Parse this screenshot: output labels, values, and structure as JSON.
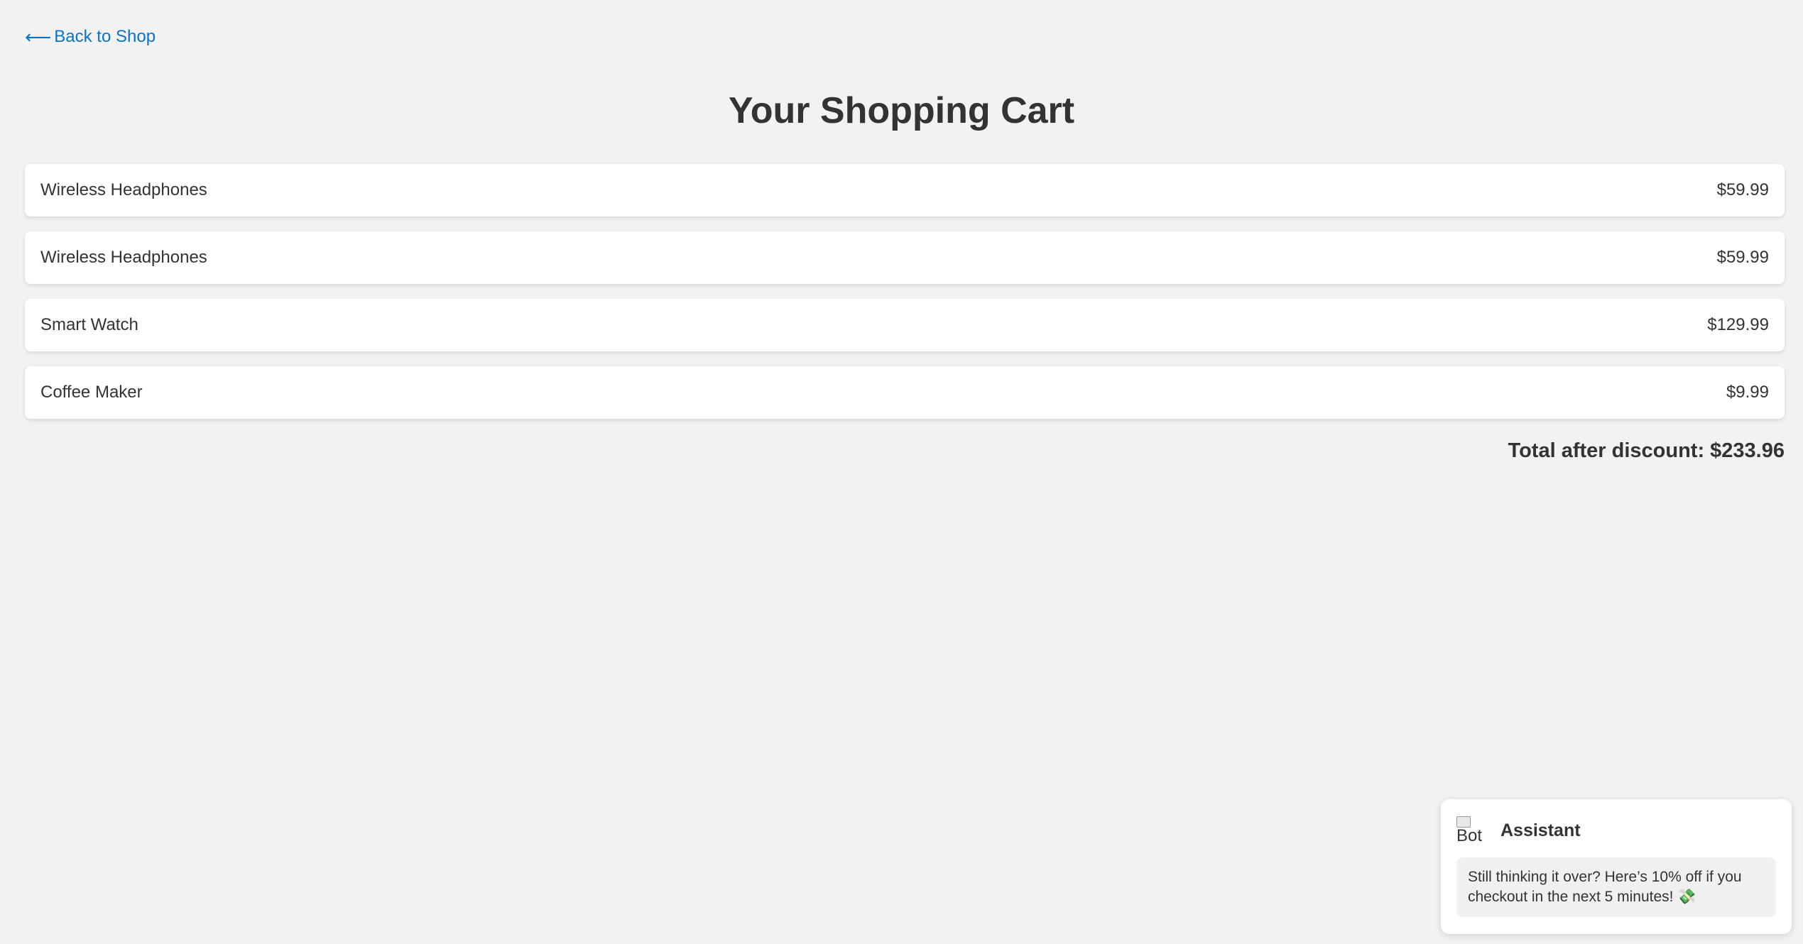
{
  "nav": {
    "back_arrow": "⟵",
    "back_label": "Back to Shop"
  },
  "page": {
    "title": "Your Shopping Cart"
  },
  "cart": {
    "items": [
      {
        "name": "Wireless Headphones",
        "price": "$59.99"
      },
      {
        "name": "Wireless Headphones",
        "price": "$59.99"
      },
      {
        "name": "Smart Watch",
        "price": "$129.99"
      },
      {
        "name": "Coffee Maker",
        "price": "$9.99"
      }
    ],
    "total_text": "Total after discount: $233.96"
  },
  "chat": {
    "avatar_alt": "Bot",
    "name": "Assistant",
    "message": "Still thinking it over? Here’s 10% off if you checkout in the next 5 minutes! 💸"
  },
  "colors": {
    "background": "#f2f2f2",
    "link": "#0b72c9",
    "card": "#ffffff",
    "text": "#333333"
  }
}
